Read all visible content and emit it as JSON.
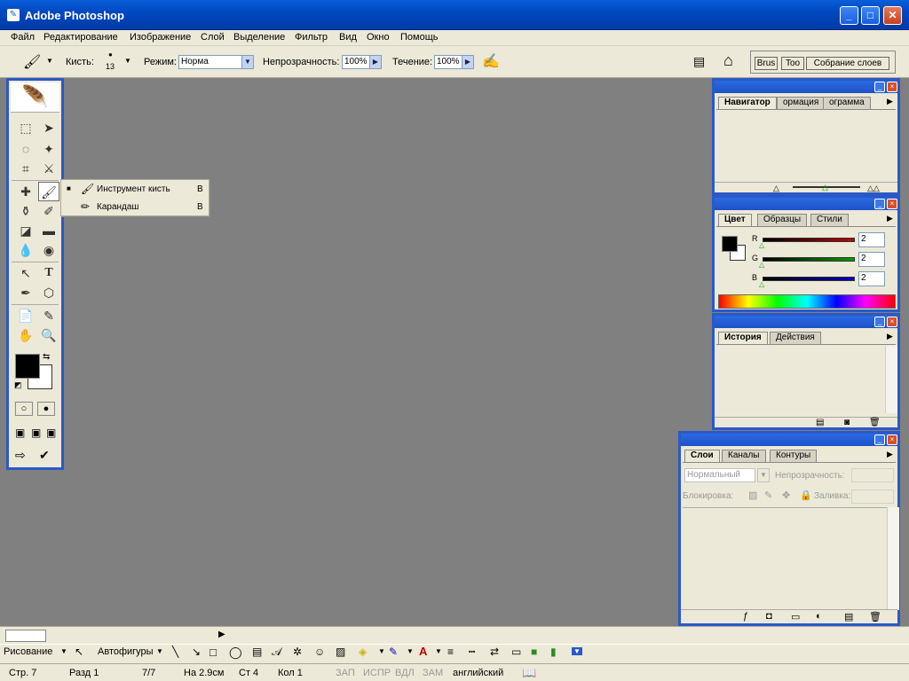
{
  "app": {
    "title": "Adobe Photoshop"
  },
  "menu": [
    "Файл",
    "Редактирование",
    "Изображение",
    "Слой",
    "Выделение",
    "Фильтр",
    "Вид",
    "Окно",
    "Помощь"
  ],
  "options": {
    "brush_label": "Кисть:",
    "brush_size": "13",
    "mode_label": "Режим:",
    "mode_value": "Норма",
    "opacity_label": "Непрозрачность:",
    "opacity_value": "100%",
    "flow_label": "Течение:",
    "flow_value": "100%",
    "well_tabs": [
      "Brus",
      "Too",
      "Собрание слоев"
    ]
  },
  "flyout": {
    "items": [
      {
        "label": "Инструмент кисть",
        "key": "B",
        "selected_mark": "■"
      },
      {
        "label": "Карандаш",
        "key": "B"
      }
    ]
  },
  "navigator": {
    "tabs": [
      "Навигатор",
      "ормация",
      "ограмма"
    ]
  },
  "color": {
    "tabs": [
      "Цвет",
      "Образцы",
      "Стили"
    ],
    "channels": [
      {
        "name": "R",
        "value": "2",
        "color": "#c00000"
      },
      {
        "name": "G",
        "value": "2",
        "color": "#00a000"
      },
      {
        "name": "B",
        "value": "2",
        "color": "#0000c0"
      }
    ]
  },
  "history": {
    "tabs": [
      "История",
      "Действия"
    ]
  },
  "layers": {
    "tabs": [
      "Слои",
      "Каналы",
      "Контуры"
    ],
    "blend_mode": "Нормальный",
    "opacity_label": "Непрозрачность:",
    "lock_label": "Блокировка:",
    "fill_label": "Заливка:"
  },
  "drawbar": {
    "draw_label": "Рисование",
    "autoshapes_label": "Автофигуры"
  },
  "status": {
    "page": "Стр. 7",
    "section": "Разд 1",
    "pages": "7/7",
    "position": "На 2.9см",
    "line": "Ст 4",
    "column": "Кол 1",
    "rec": "ЗАП",
    "trk": "ИСПР",
    "ext": "ВДЛ",
    "ovr": "ЗАМ",
    "language": "английский"
  }
}
